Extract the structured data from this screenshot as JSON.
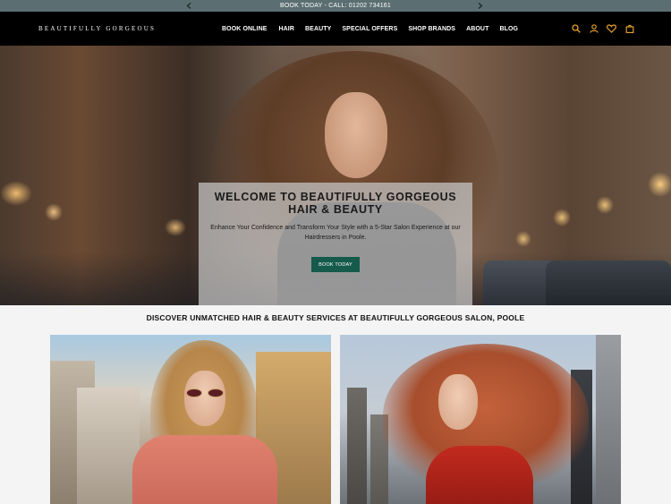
{
  "announcement": {
    "text": "BOOK TODAY - CALL: 01202 734161",
    "prev_icon": "chevron-left-icon",
    "next_icon": "chevron-right-icon"
  },
  "header": {
    "logo": "BEAUTIFULLY GORGEOUS",
    "nav": [
      {
        "label": "BOOK ONLINE"
      },
      {
        "label": "HAIR"
      },
      {
        "label": "BEAUTY"
      },
      {
        "label": "SPECIAL OFFERS"
      },
      {
        "label": "SHOP BRANDS"
      },
      {
        "label": "ABOUT"
      },
      {
        "label": "BLOG"
      }
    ],
    "icons": [
      "search-icon",
      "account-icon",
      "heart-icon",
      "bag-icon"
    ],
    "accent_color": "#e0a030"
  },
  "hero": {
    "title": "WELCOME TO BEAUTIFULLY GORGEOUS HAIR & BEAUTY",
    "subtitle": "Enhance Your Confidence and Transform Your Style with a 5-Star Salon Experience at our Hairdressers in Poole.",
    "button_label": "BOOK TODAY",
    "button_color": "#155a4a"
  },
  "services": {
    "title": "DISCOVER UNMATCHED HAIR & BEAUTY SERVICES AT BEAUTIFULLY GORGEOUS SALON, POOLE"
  }
}
